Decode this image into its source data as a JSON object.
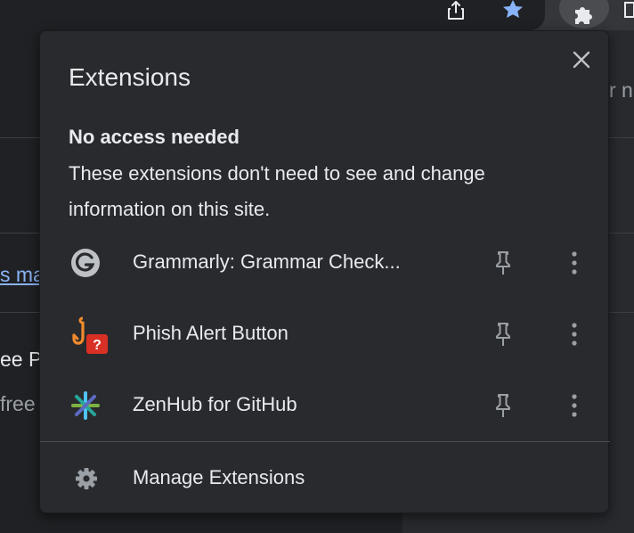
{
  "toolbar": {
    "icons": [
      "share-icon",
      "star-icon",
      "extensions-puzzle-icon"
    ]
  },
  "background_page": {
    "link_fragment": "s ma",
    "heading_fragment": "ee P",
    "text_fragment": "free",
    "right_fragment": "r n"
  },
  "popup": {
    "title": "Extensions",
    "section": {
      "heading": "No access needed",
      "description": "These extensions don't need to see and change information on this site."
    },
    "extensions": [
      {
        "name": "Grammarly: Grammar Check...",
        "icon": "grammarly-icon"
      },
      {
        "name": "Phish Alert Button",
        "icon": "phish-alert-icon"
      },
      {
        "name": "ZenHub for GitHub",
        "icon": "zenhub-icon"
      }
    ],
    "manage_label": "Manage Extensions"
  },
  "colors": {
    "popup_bg": "#292a2d",
    "text": "#e8eaed",
    "icon_gray": "#9aa0a6",
    "star_blue": "#8ab4f8",
    "link_blue": "#8ab4f8"
  }
}
